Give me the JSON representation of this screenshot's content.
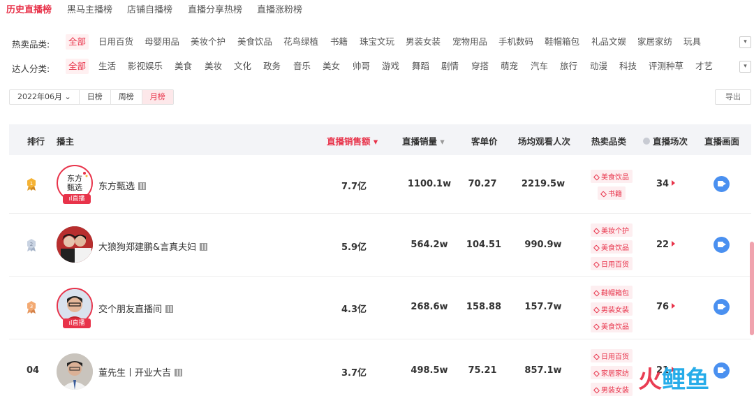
{
  "topnav": [
    "历史直播榜",
    "黑马主播榜",
    "店铺自播榜",
    "直播分享热榜",
    "直播涨粉榜"
  ],
  "hot_category": {
    "label": "热卖品类:",
    "items": [
      "全部",
      "日用百货",
      "母婴用品",
      "美妆个护",
      "美食饮品",
      "花鸟绿植",
      "书籍",
      "珠宝文玩",
      "男装女装",
      "宠物用品",
      "手机数码",
      "鞋帽箱包",
      "礼品文娱",
      "家居家纺",
      "玩具"
    ]
  },
  "talent_category": {
    "label": "达人分类:",
    "items": [
      "全部",
      "生活",
      "影视娱乐",
      "美食",
      "美妆",
      "文化",
      "政务",
      "音乐",
      "美女",
      "帅哥",
      "游戏",
      "舞蹈",
      "剧情",
      "穿搭",
      "萌宠",
      "汽车",
      "旅行",
      "动漫",
      "科技",
      "评测种草",
      "才艺"
    ]
  },
  "datebar": {
    "month_select": "2022年06月",
    "day": "日榜",
    "week": "周榜",
    "month": "月榜"
  },
  "export_label": "导出",
  "table": {
    "headers": {
      "rank": "排行",
      "anchor": "播主",
      "sales": "直播销售额",
      "volume": "直播销量",
      "price": "客单价",
      "views": "场均观看人次",
      "category": "热卖品类",
      "sessions": "直播场次",
      "screen": "直播画面"
    },
    "live_label": "直播",
    "rows": [
      {
        "rank": "1",
        "name": "东方甄选",
        "sales": "7.7亿",
        "volume": "1100.1w",
        "price": "70.27",
        "views": "2219.5w",
        "tags": [
          "美食饮品",
          "书籍"
        ],
        "sessions": "34",
        "live": true,
        "avatar_text": "东方甄选"
      },
      {
        "rank": "2",
        "name": "大狼狗郑建鹏&言真夫妇",
        "sales": "5.9亿",
        "volume": "564.2w",
        "price": "104.51",
        "views": "990.9w",
        "tags": [
          "美妆个护",
          "美食饮品",
          "日用百货"
        ],
        "sessions": "22",
        "live": false
      },
      {
        "rank": "3",
        "name": "交个朋友直播间",
        "sales": "4.3亿",
        "volume": "268.6w",
        "price": "158.88",
        "views": "157.7w",
        "tags": [
          "鞋帽箱包",
          "男装女装",
          "美食饮品"
        ],
        "sessions": "76",
        "live": true
      },
      {
        "rank": "04",
        "name": "董先生丨开业大吉",
        "sales": "3.7亿",
        "volume": "498.5w",
        "price": "75.21",
        "views": "857.1w",
        "tags": [
          "日用百货",
          "家居家纺",
          "男装女装"
        ],
        "sessions": "21",
        "live": false
      }
    ]
  },
  "watermark": {
    "a": "火",
    "b": "鲤鱼"
  },
  "colors": {
    "accent": "#e8334a",
    "play": "#4a90f0"
  }
}
